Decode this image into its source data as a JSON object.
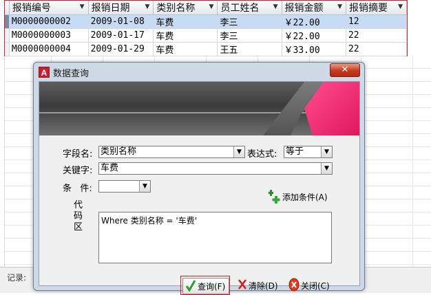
{
  "grid": {
    "columns": [
      "报销编号",
      "报销日期",
      "类别名称",
      "员工姓名",
      "报销金额",
      "报销摘要"
    ],
    "rows": [
      {
        "id": "M0000000002",
        "date": "2009-01-08",
        "category": "车费",
        "employee": "李三",
        "amount": "￥22.00",
        "summary": "12"
      },
      {
        "id": "M0000000003",
        "date": "2009-01-17",
        "category": "车费",
        "employee": "李三",
        "amount": "￥22.00",
        "summary": "22"
      },
      {
        "id": "M0000000004",
        "date": "2009-01-29",
        "category": "车费",
        "employee": "王五",
        "amount": "￥33.00",
        "summary": "22"
      }
    ]
  },
  "status": {
    "record_label": "记录: "
  },
  "dialog": {
    "title": "数据查询",
    "app_icon": "A",
    "close_glyph": "✕",
    "field_label": "字段名:",
    "field_value": "类别名称",
    "expr_label": "表达式:",
    "expr_value": "等于",
    "keyword_label": "关键字:",
    "keyword_value": "车费",
    "condition_label": "条   件:",
    "condition_value": "",
    "add_condition_label": "添加条件(A)",
    "code_label": "代\n码\n区",
    "code_text": "Where 类别名称 = '车费'",
    "query_button": "查询(F)",
    "clear_button": "清除(D)",
    "close_button": "关闭(C)"
  },
  "icons": {
    "dropdown": "dropdown-arrow-icon",
    "add": "add-condition-icon",
    "check": "check-icon",
    "clear": "clear-x-icon",
    "close": "close-circle-icon"
  },
  "colors": {
    "highlight_border": "#c8202b",
    "selected_row": "#c8dbf5",
    "banner_pink": "#e0185e"
  }
}
